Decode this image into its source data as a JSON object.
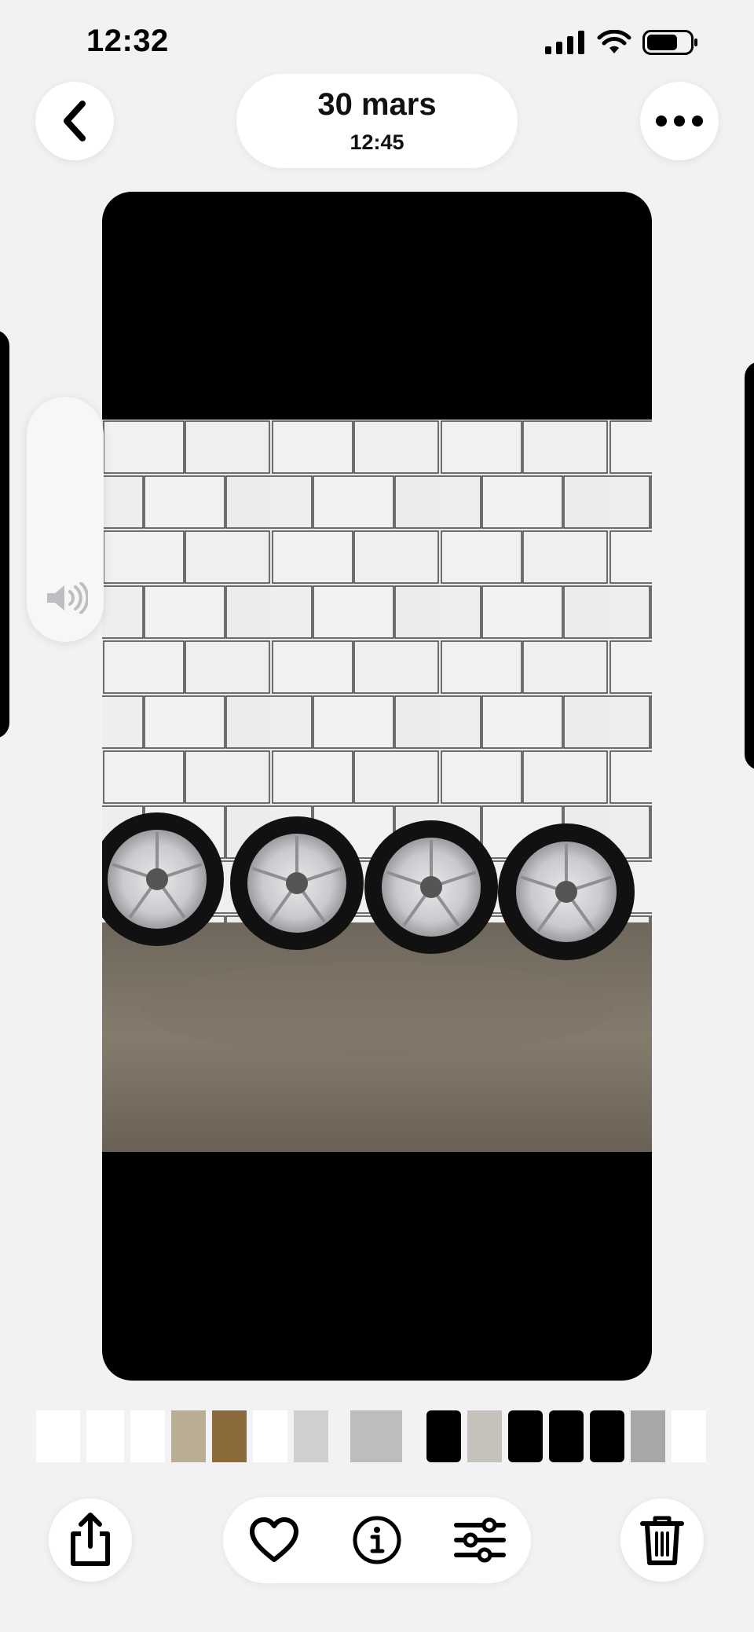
{
  "status_bar": {
    "time": "12:32"
  },
  "header": {
    "date": "30 mars",
    "time": "12:45"
  },
  "icons": {
    "back": "chevron-left-icon",
    "more": "ellipsis-icon",
    "volume": "speaker-icon",
    "share": "share-icon",
    "favorite": "heart-icon",
    "info": "info-icon",
    "adjust": "sliders-icon",
    "delete": "trash-icon"
  },
  "photo": {
    "subject": "Four alloy wheels with tires against a white tiled wall"
  },
  "colors": {
    "background": "#f2f2f4",
    "frame": "#000000",
    "accent": "#000000"
  }
}
